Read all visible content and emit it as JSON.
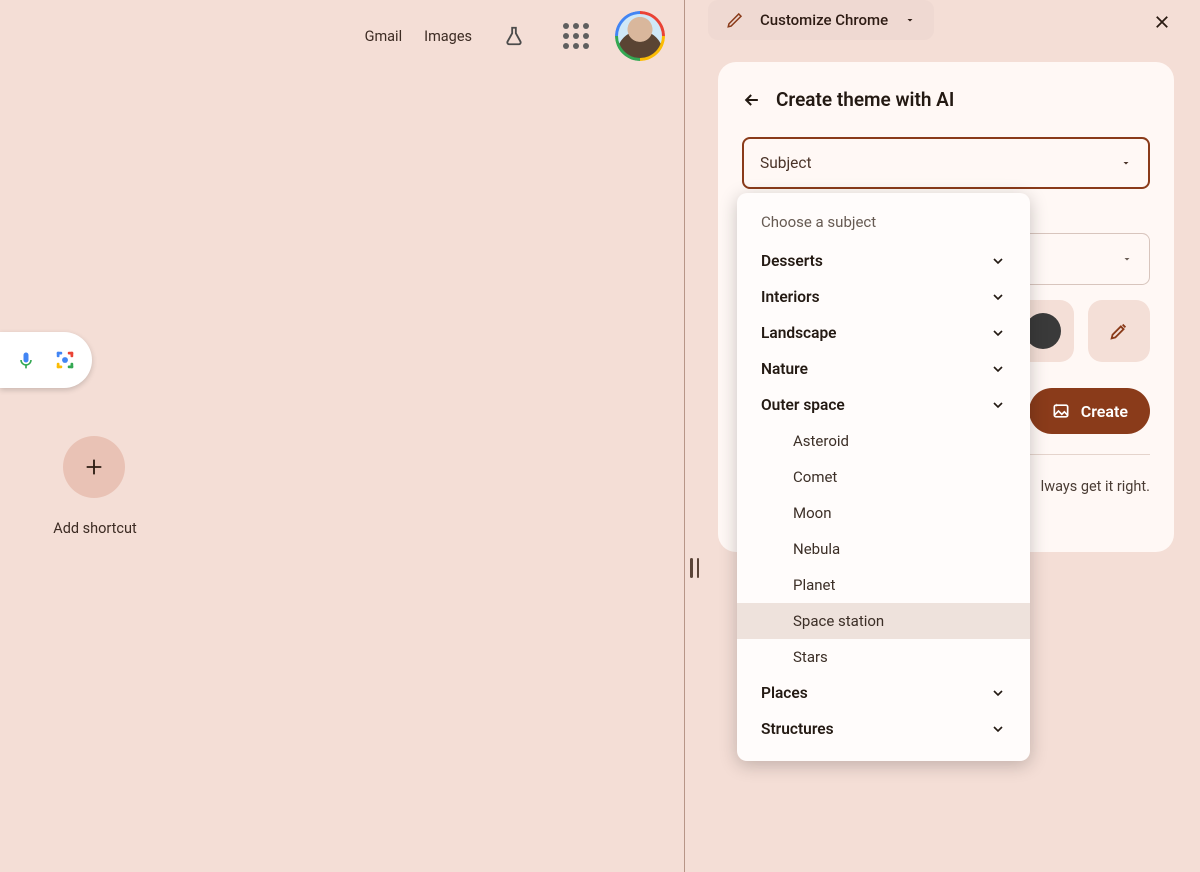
{
  "topbar": {
    "gmail": "Gmail",
    "images": "Images"
  },
  "shortcut": {
    "add_label": "Add shortcut"
  },
  "customize_chip": "Customize Chrome",
  "panel": {
    "title": "Create theme with AI",
    "subject_label": "Subject",
    "create_label": "Create",
    "disclaimer_tail": "lways get it right."
  },
  "dropdown": {
    "hint": "Choose a subject",
    "categories": [
      {
        "label": "Desserts",
        "expanded": false
      },
      {
        "label": "Interiors",
        "expanded": false
      },
      {
        "label": "Landscape",
        "expanded": false
      },
      {
        "label": "Nature",
        "expanded": false
      },
      {
        "label": "Outer space",
        "expanded": true,
        "items": [
          "Asteroid",
          "Comet",
          "Moon",
          "Nebula",
          "Planet",
          "Space station",
          "Stars"
        ],
        "hovered_index": 5
      },
      {
        "label": "Places",
        "expanded": false
      },
      {
        "label": "Structures",
        "expanded": false
      }
    ]
  }
}
